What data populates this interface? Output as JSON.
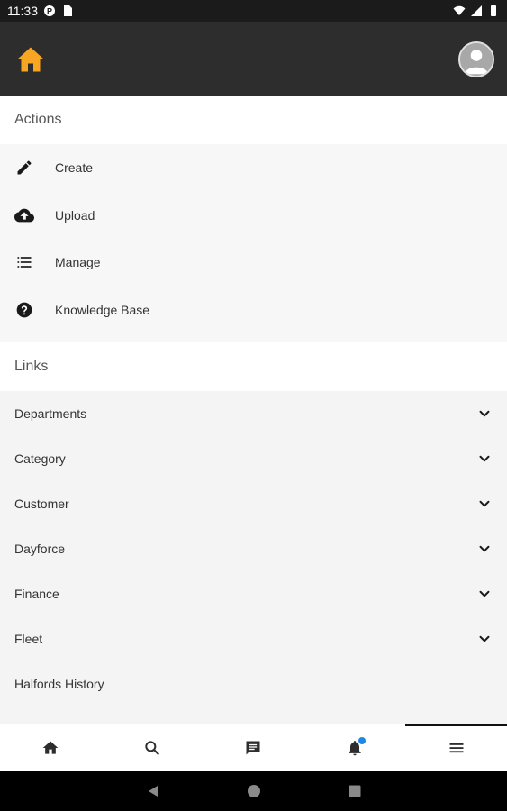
{
  "status_bar": {
    "time": "11:33"
  },
  "actions": {
    "header": "Actions",
    "items": [
      {
        "label": "Create",
        "icon": "pencil-icon"
      },
      {
        "label": "Upload",
        "icon": "cloud-upload-icon"
      },
      {
        "label": "Manage",
        "icon": "list-icon"
      },
      {
        "label": "Knowledge Base",
        "icon": "help-circle-icon"
      }
    ]
  },
  "links": {
    "header": "Links",
    "items": [
      {
        "label": "Departments",
        "expandable": true
      },
      {
        "label": "Category",
        "expandable": true
      },
      {
        "label": "Customer",
        "expandable": true
      },
      {
        "label": "Dayforce",
        "expandable": true
      },
      {
        "label": "Finance",
        "expandable": true
      },
      {
        "label": "Fleet",
        "expandable": true
      },
      {
        "label": "Halfords History",
        "expandable": false
      }
    ]
  },
  "bottom_nav": {
    "items": [
      {
        "icon": "home-icon"
      },
      {
        "icon": "search-icon"
      },
      {
        "icon": "message-icon"
      },
      {
        "icon": "bell-icon",
        "has_badge": true
      },
      {
        "icon": "menu-icon",
        "active": true
      }
    ]
  },
  "colors": {
    "app_bar": "#2d2d2d",
    "home_icon": "#f6a623",
    "badge": "#1e88e5"
  }
}
